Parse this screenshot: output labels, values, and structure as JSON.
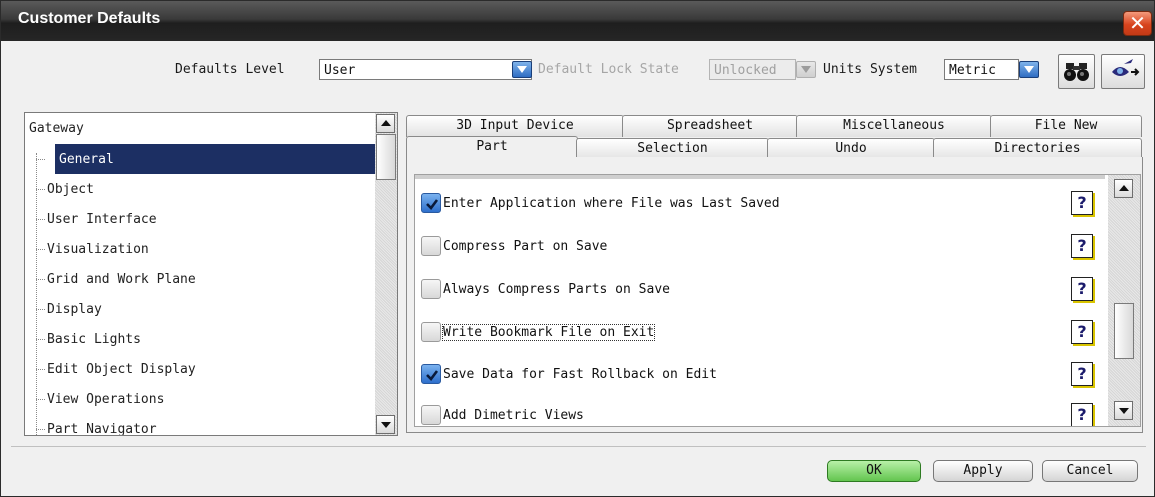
{
  "window": {
    "title": "Customer Defaults",
    "close_glyph": "✕"
  },
  "header": {
    "defaults_level_label": "Defaults Level",
    "defaults_level_value": "User",
    "lock_state_label": "Default Lock State",
    "lock_state_value": "Unlocked",
    "units_label": "Units System",
    "units_value": "Metric",
    "find_icon": "binoculars-icon",
    "back_icon": "eye-arrow-icon"
  },
  "tree": {
    "root": "Gateway",
    "items": [
      "General",
      "Object",
      "User Interface",
      "Visualization",
      "Grid and Work Plane",
      "Display",
      "Basic Lights",
      "Edit Object Display",
      "View Operations",
      "Part Navigator"
    ],
    "selected": "General"
  },
  "tabs": {
    "row1": [
      "3D Input Device",
      "Spreadsheet",
      "Miscellaneous",
      "File New"
    ],
    "row2": [
      "Part",
      "Selection",
      "Undo",
      "Directories"
    ],
    "active": "Part"
  },
  "options": [
    {
      "label": "Enter Application where File was Last Saved",
      "checked": true
    },
    {
      "label": "Compress Part on Save",
      "checked": false
    },
    {
      "label": "Always Compress Parts on Save",
      "checked": false
    },
    {
      "label": "Write Bookmark File on Exit",
      "checked": false
    },
    {
      "label": "Save Data for Fast Rollback on Edit",
      "checked": true
    },
    {
      "label": "Add Dimetric Views",
      "checked": false
    }
  ],
  "help_glyph": "?",
  "buttons": {
    "ok": "OK",
    "apply": "Apply",
    "cancel": "Cancel"
  }
}
